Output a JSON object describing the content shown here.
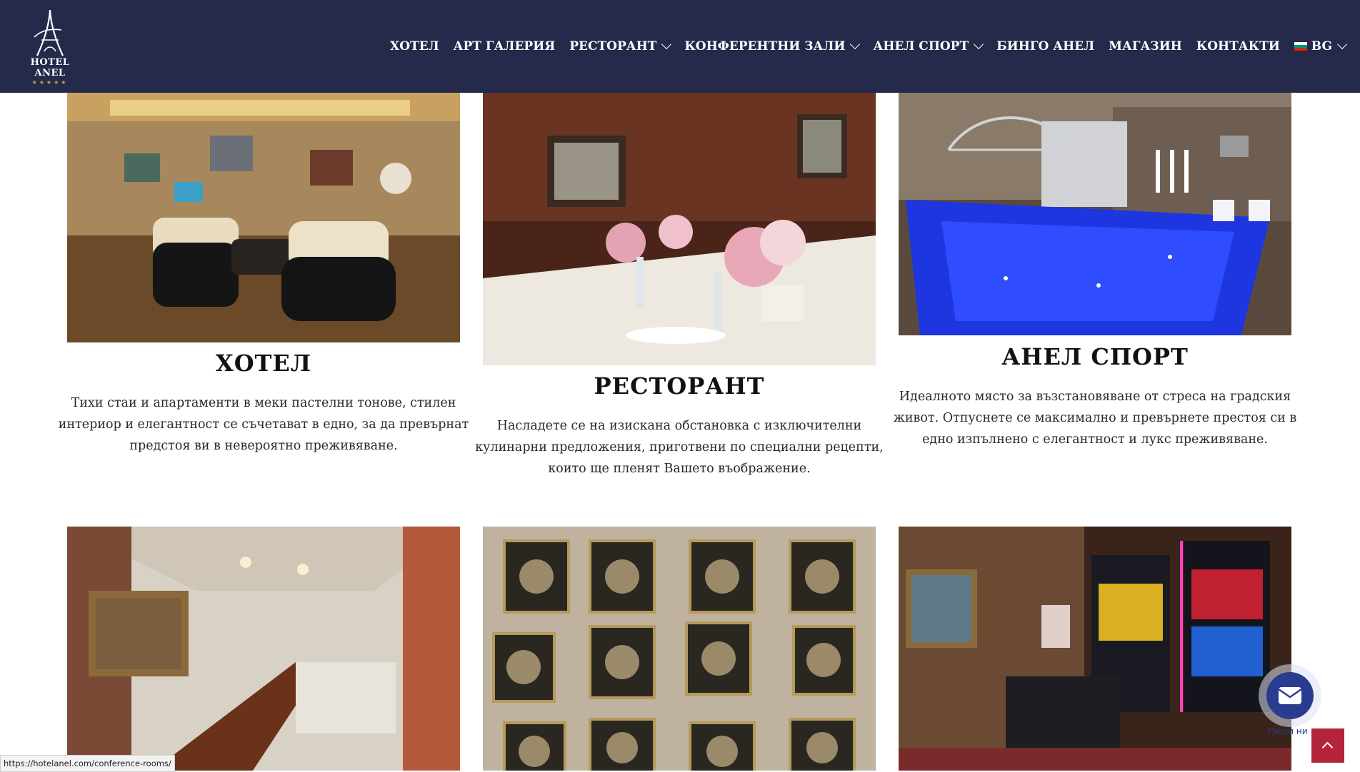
{
  "brand": {
    "name": "HOTEL ANEL",
    "stars": "★★★★★"
  },
  "nav": {
    "items": [
      {
        "label": "ХОТЕЛ",
        "dropdown": false
      },
      {
        "label": "АРТ ГАЛЕРИЯ",
        "dropdown": false
      },
      {
        "label": "РЕСТОРАНТ",
        "dropdown": true
      },
      {
        "label": "КОНФЕРЕНТНИ ЗАЛИ",
        "dropdown": true
      },
      {
        "label": "АНЕЛ СПОРТ",
        "dropdown": true
      },
      {
        "label": "БИНГО АНЕЛ",
        "dropdown": false
      },
      {
        "label": "МАГАЗИН",
        "dropdown": false
      },
      {
        "label": "КОНТАКТИ",
        "dropdown": false
      }
    ],
    "language": "BG"
  },
  "cards": [
    {
      "title": "ХОТЕЛ",
      "text": "Тихи стаи и апартаменти в меки пастелни тонове, стилен интериор и елегантност се съчетават в едно, за да превърнат предстоя ви в невероятно преживяване.",
      "image": "hotel-lounge-photo"
    },
    {
      "title": "РЕСТОРАНТ",
      "text": "Насладете се на изискана обстановка с изключителни кулинарни предложения, приготвени по специални рецепти, които ще пленят Вашето въображение.",
      "image": "restaurant-table-photo"
    },
    {
      "title": "АНЕЛ СПОРТ",
      "text": "Идеалното място за възстановяване от стреса на градския живот. Отпуснете се максимално и превърнете престоя си в едно изпълнено с елегантност и лукс преживяване.",
      "image": "pool-photo"
    }
  ],
  "bottom_images": [
    "conference-room-photo",
    "art-gallery-photo",
    "bingo-slot-machines-photo"
  ],
  "status_url": "https://hotelanel.com/conference-rooms/",
  "contact_widget": {
    "label": "Пиши ни",
    "icon": "envelope-icon"
  },
  "scroll_top": {
    "icon": "chevron-up-icon"
  },
  "colors": {
    "navbar": "#25294a",
    "accent_red": "#b3243b",
    "contact_blue": "#2a3c8f",
    "star_gold": "#c9a24a"
  }
}
